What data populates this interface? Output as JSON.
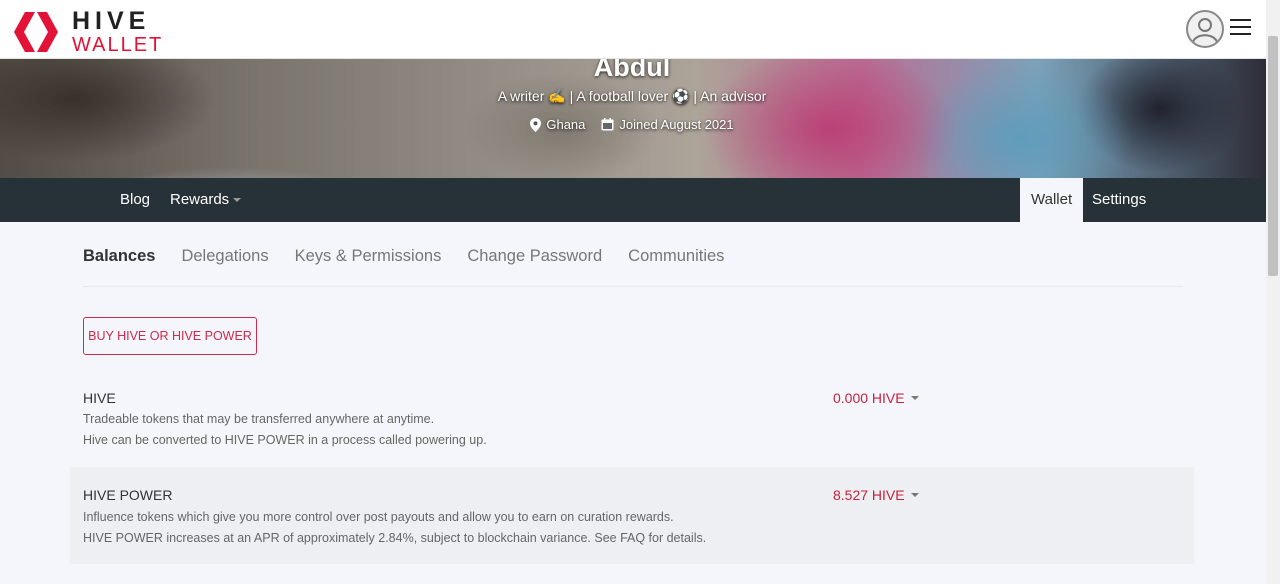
{
  "header": {
    "logo_line1": "HIVE",
    "logo_line2": "WALLET",
    "brand_color": "#e31337"
  },
  "profile": {
    "name": "Abdul",
    "about": "A writer ✍️ | A football lover ⚽ | An advisor",
    "location": "Ghana",
    "joined": "Joined August 2021"
  },
  "nav": {
    "left": [
      "Blog",
      "Rewards"
    ],
    "right": [
      "Wallet",
      "Settings"
    ],
    "active": "Wallet"
  },
  "tabs": {
    "items": [
      "Balances",
      "Delegations",
      "Keys & Permissions",
      "Change Password",
      "Communities"
    ],
    "active": "Balances"
  },
  "buy_button": "BUY HIVE OR HIVE POWER",
  "balances": [
    {
      "title": "HIVE",
      "desc1": "Tradeable tokens that may be transferred anywhere at anytime.",
      "desc2": "Hive can be converted to HIVE POWER in a process called powering up.",
      "value": "0.000 HIVE"
    },
    {
      "title": "HIVE POWER",
      "desc1": "Influence tokens which give you more control over post payouts and allow you to earn on curation rewards.",
      "desc2": "HIVE POWER increases at an APR of approximately 2.84%, subject to blockchain variance. See FAQ for details.",
      "value": "8.527 HIVE"
    }
  ],
  "icons": {
    "location": "location-pin-icon",
    "calendar": "calendar-icon",
    "avatar": "user-avatar-icon",
    "menu": "hamburger-menu-icon"
  }
}
